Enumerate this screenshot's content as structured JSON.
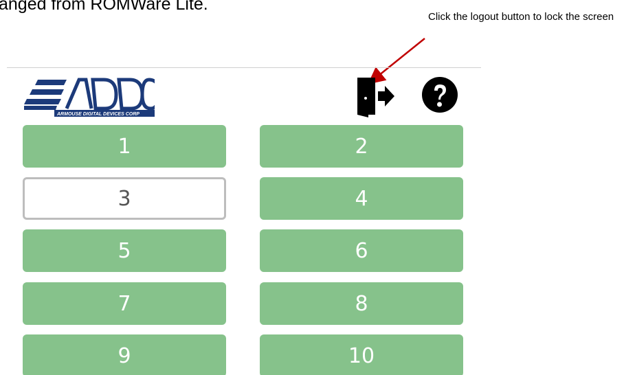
{
  "document": {
    "text": "anged from ROMWare Lite."
  },
  "annotation": {
    "callout_text": "Click the logout button to lock the screen",
    "arrow_color": "#c00000"
  },
  "app": {
    "logo": {
      "text": "ADDC",
      "subtitle": "ARMOUSE DIGITAL DEVICES CORP",
      "color": "#1c3a7a"
    },
    "toolbar": {
      "logout_icon": "logout-door-icon",
      "help_icon": "question-circle-icon"
    },
    "buttons": [
      {
        "label": "1",
        "selected": false
      },
      {
        "label": "2",
        "selected": false
      },
      {
        "label": "3",
        "selected": true
      },
      {
        "label": "4",
        "selected": false
      },
      {
        "label": "5",
        "selected": false
      },
      {
        "label": "6",
        "selected": false
      },
      {
        "label": "7",
        "selected": false
      },
      {
        "label": "8",
        "selected": false
      },
      {
        "label": "9",
        "selected": false
      },
      {
        "label": "10",
        "selected": false
      }
    ],
    "colors": {
      "button_bg": "#86c28b",
      "selected_border": "#bdbdbd"
    }
  }
}
